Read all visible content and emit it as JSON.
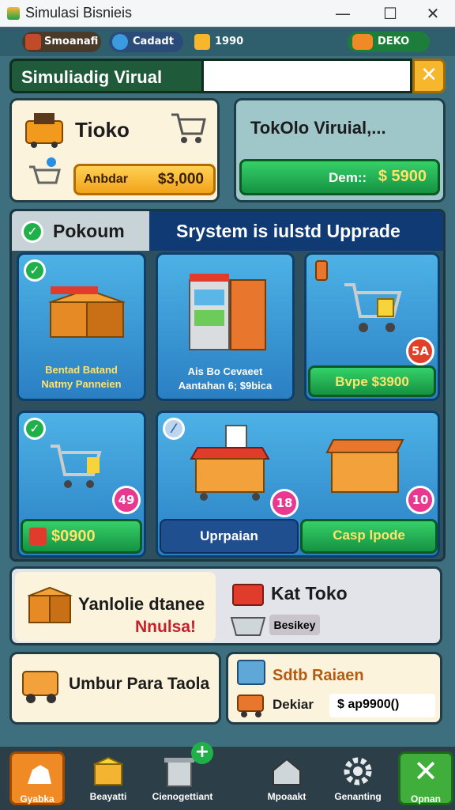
{
  "window": {
    "title": "Simulasi Bisnieis",
    "controls": [
      "—",
      "☐",
      "✕"
    ]
  },
  "status": {
    "item1": "Smoanafi",
    "item2": "Cadadt",
    "item3": "1990",
    "item4": "DEKO"
  },
  "search": {
    "label": "Simuliadig Virual",
    "value": "",
    "clear": "✕"
  },
  "toko": {
    "title": "Tioko",
    "button": "Anbdar",
    "price": "$3,000"
  },
  "toko_virtual": {
    "title": "TokOlo Viruial,...",
    "button": "Dem::",
    "price": "$ 5900"
  },
  "panel": {
    "left_title": "Pokoum",
    "right_title": "Srystem is iulstd Upprade"
  },
  "tiles": {
    "t1": {
      "line1": "Bentad Batand",
      "line2": "Natmy Panneien"
    },
    "t2": {
      "line1": "Ais Bo Cevaeet",
      "line2": "Aantahan 6; $9bica"
    },
    "t3": {
      "button": "Bvpe $3900",
      "badge": "5A"
    },
    "t4": {
      "badge": "49",
      "price": "$0900"
    },
    "t5": {
      "badge_a": "18",
      "badge_b": "10",
      "btn_left": "Uprpaian",
      "btn_right": "Casp lpode"
    }
  },
  "row1": {
    "left_title": "Yanlolie dtanee",
    "left_sub": "Nnulsa!",
    "right_title": "Kat Toko",
    "right_tag": "Besikey"
  },
  "row2": {
    "left_title": "Umbur Para Taola",
    "right_title": "Sdtb Raiaen",
    "right_label": "Dekiar",
    "right_value": "$ ap9900()"
  },
  "nav": [
    "Gyabka",
    "Beayatti",
    "Cienogettiant",
    "Mpoaakt",
    "Genanting",
    "Opnan"
  ],
  "colors": {
    "accent_green": "#159241",
    "accent_orange": "#f2a31a",
    "panel_blue": "#0f3a73",
    "badge_pink": "#e8388f"
  }
}
